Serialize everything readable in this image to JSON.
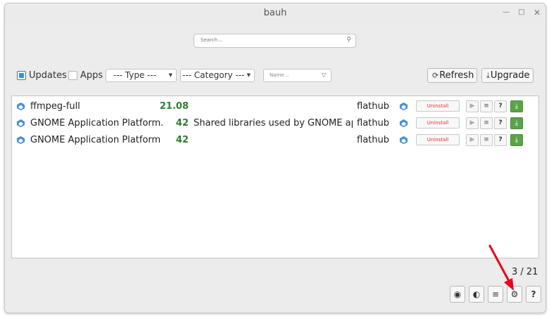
{
  "window": {
    "title": "bauh",
    "minimize_icon": "minimize-icon",
    "maximize_icon": "maximize-icon",
    "close_icon": "close-icon"
  },
  "search": {
    "placeholder": "Search...",
    "icon": "search-icon"
  },
  "filters": {
    "updates_label": "Updates",
    "updates_checked": true,
    "apps_label": "Apps",
    "apps_checked": false,
    "type_label": "--- Type ---",
    "category_label": "--- Category ---",
    "name_placeholder": "Name...",
    "refresh_label": "Refresh",
    "upgrade_label": "Upgrade"
  },
  "packages": [
    {
      "name": "ffmpeg-full",
      "version": "21.08",
      "description": "",
      "repo": "flathub",
      "uninstall": "Uninstall"
    },
    {
      "name": "GNOME Application Platform...",
      "version": "42",
      "description": "Shared libraries used by GNOME app...",
      "repo": "flathub",
      "uninstall": "Uninstall"
    },
    {
      "name": "GNOME Application Platform ...",
      "version": "42",
      "description": "",
      "repo": "flathub",
      "uninstall": "Uninstall"
    }
  ],
  "pagination": {
    "count": "3 / 21"
  },
  "bottom_buttons": [
    "lightbulb-icon",
    "palette-icon",
    "menu-icon",
    "gear-icon",
    "help-icon"
  ],
  "colors": {
    "version_green": "#2e7d32",
    "uninstall_red": "#dd3333",
    "download_green": "#5aa34a",
    "annotation_red": "#e8001c"
  }
}
